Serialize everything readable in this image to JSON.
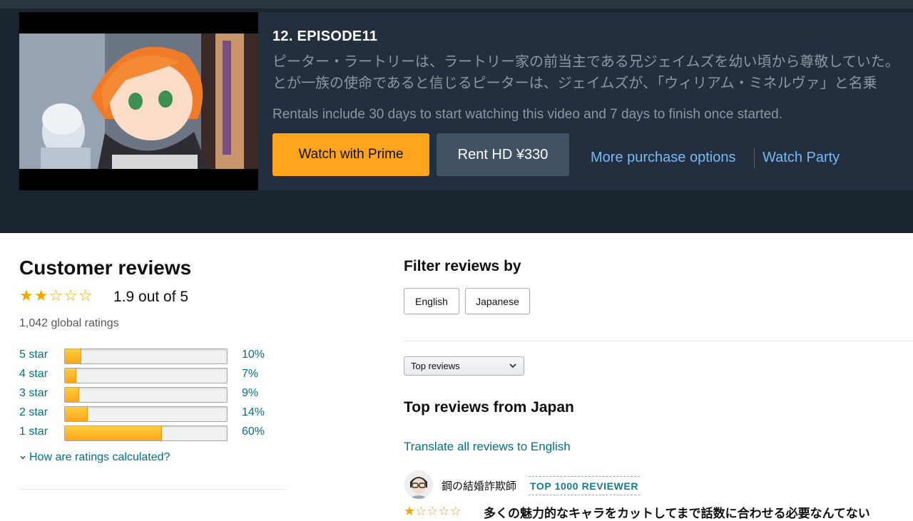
{
  "episode": {
    "title": "12. EPISODE11",
    "synopsis_line1": "ピーター・ラートリーは、ラートリー家の前当主である兄ジェイムズを幼い頃から尊敬していた。",
    "synopsis_line2": "とが一族の使命であると信じるピーターは、ジェイムズが、「ウィリアム・ミネルヴァ」と名乗",
    "rental_note": "Rentals include 30 days to start watching this video and 7 days to finish once started.",
    "watch_prime_label": "Watch with Prime",
    "rent_label": "Rent HD ¥330",
    "more_options_label": "More purchase options",
    "watch_party_label": "Watch Party"
  },
  "reviews_summary": {
    "title": "Customer reviews",
    "rating_value": 1.9,
    "average_text": "1.9 out of 5",
    "global_ratings": "1,042 global ratings",
    "histogram": [
      {
        "label": "5 star",
        "percent": 10,
        "percent_text": "10%"
      },
      {
        "label": "4 star",
        "percent": 7,
        "percent_text": "7%"
      },
      {
        "label": "3 star",
        "percent": 9,
        "percent_text": "9%"
      },
      {
        "label": "2 star",
        "percent": 14,
        "percent_text": "14%"
      },
      {
        "label": "1 star",
        "percent": 60,
        "percent_text": "60%"
      }
    ],
    "how_calculated": "How are ratings calculated?"
  },
  "filters": {
    "title": "Filter reviews by",
    "chips": [
      "English",
      "Japanese"
    ],
    "sort_selected": "Top reviews"
  },
  "top_reviews": {
    "title": "Top reviews from Japan",
    "translate_link": "Translate all reviews to English",
    "first_review": {
      "reviewer": "鋼の結婚詐欺師",
      "badge": "TOP 1000 REVIEWER",
      "rating": 1,
      "headline": "多くの魅力的なキャラをカットしてまで話数に合わせる必要なんてない"
    }
  },
  "colors": {
    "accent_orange": "#ffa41c",
    "link_teal": "#007185",
    "dark_link": "#79b8f3",
    "dark_bg": "#1a242f",
    "star": "#f0a800"
  },
  "icons": {
    "chevron": "chevron-down-icon",
    "star": "star-icon"
  }
}
